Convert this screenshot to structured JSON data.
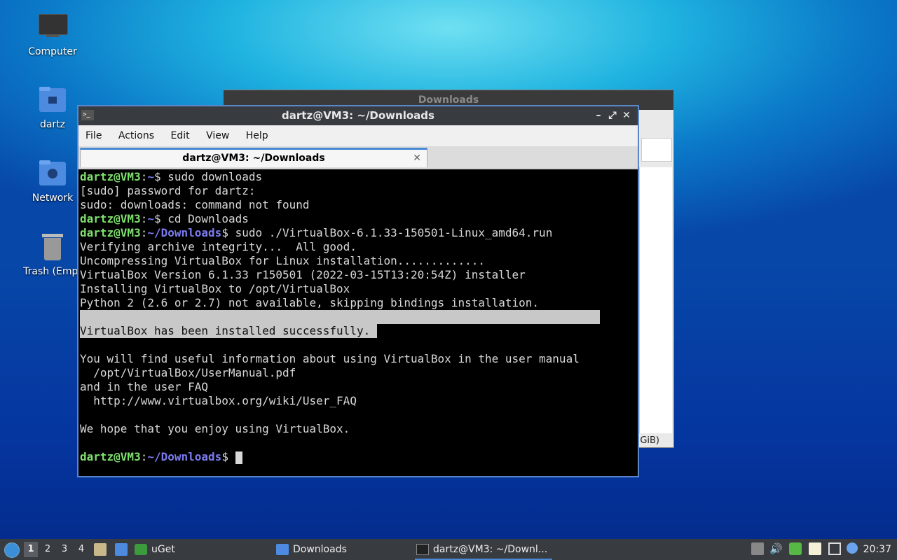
{
  "desktop": {
    "icons": [
      {
        "label": "Computer"
      },
      {
        "label": "dartz"
      },
      {
        "label": "Network"
      },
      {
        "label": "Trash (Empt"
      }
    ]
  },
  "behind_window": {
    "title": "Downloads",
    "partial_text": "GiB)"
  },
  "terminal": {
    "title": "dartz@VM3: ~/Downloads",
    "menu": [
      "File",
      "Actions",
      "Edit",
      "View",
      "Help"
    ],
    "tab_title": "dartz@VM3: ~/Downloads",
    "prompt_user": "dartz@VM3",
    "lines": [
      {
        "type": "prompt",
        "path": "~",
        "cmd": "sudo downloads"
      },
      {
        "type": "out",
        "text": "[sudo] password for dartz:"
      },
      {
        "type": "out",
        "text": "sudo: downloads: command not found"
      },
      {
        "type": "prompt",
        "path": "~",
        "cmd": "cd Downloads"
      },
      {
        "type": "prompt",
        "path": "~/Downloads",
        "cmd": "sudo ./VirtualBox-6.1.33-150501-Linux_amd64.run"
      },
      {
        "type": "out",
        "text": "Verifying archive integrity...  All good."
      },
      {
        "type": "out",
        "text": "Uncompressing VirtualBox for Linux installation............."
      },
      {
        "type": "out",
        "text": "VirtualBox Version 6.1.33 r150501 (2022-03-15T13:20:54Z) installer"
      },
      {
        "type": "out",
        "text": "Installing VirtualBox to /opt/VirtualBox"
      },
      {
        "type": "out",
        "text": "Python 2 (2.6 or 2.7) not available, skipping bindings installation."
      },
      {
        "type": "sel",
        "text": "                                                                             "
      },
      {
        "type": "sel",
        "text": "VirtualBox has been installed successfully. "
      },
      {
        "type": "out",
        "text": ""
      },
      {
        "type": "out",
        "text": "You will find useful information about using VirtualBox in the user manual"
      },
      {
        "type": "out",
        "text": "  /opt/VirtualBox/UserManual.pdf"
      },
      {
        "type": "out",
        "text": "and in the user FAQ"
      },
      {
        "type": "out",
        "text": "  http://www.virtualbox.org/wiki/User_FAQ"
      },
      {
        "type": "out",
        "text": ""
      },
      {
        "type": "out",
        "text": "We hope that you enjoy using VirtualBox."
      },
      {
        "type": "out",
        "text": ""
      },
      {
        "type": "prompt",
        "path": "~/Downloads",
        "cmd": "",
        "cursor": true
      }
    ]
  },
  "taskbar": {
    "workspaces": [
      "1",
      "2",
      "3",
      "4"
    ],
    "tasks": [
      "uGet",
      "Downloads",
      "dartz@VM3: ~/Downl..."
    ],
    "clock": "20:37"
  }
}
